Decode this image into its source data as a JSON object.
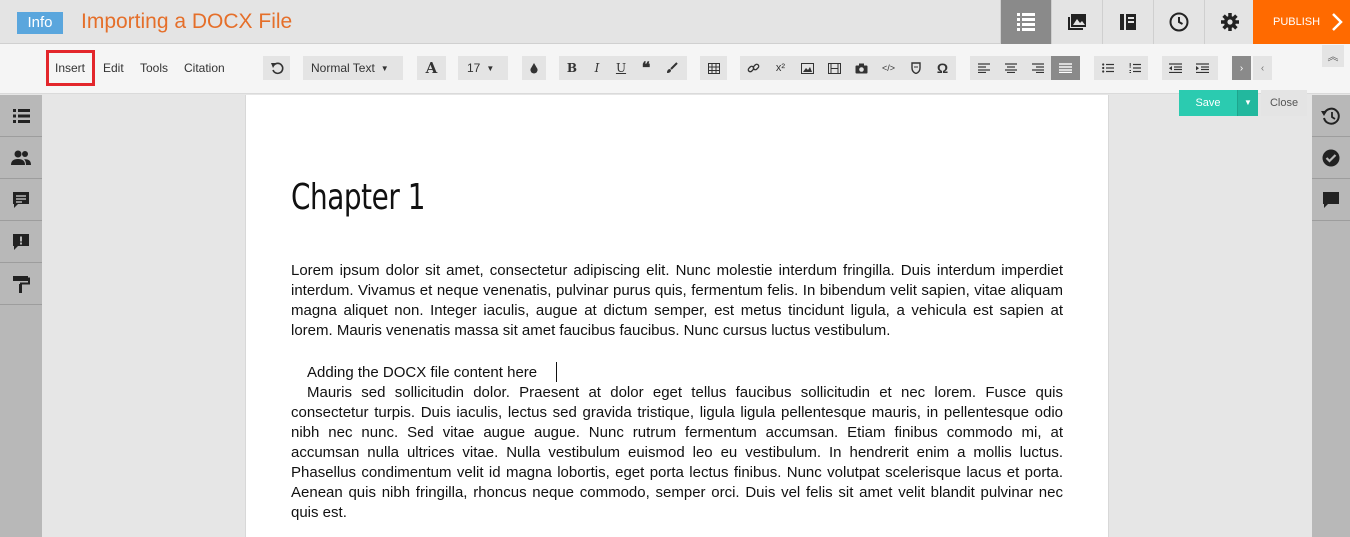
{
  "header": {
    "info_badge": "Info",
    "title": "Importing a DOCX File",
    "publish_label": "PUBLISH",
    "buttons": [
      "toc-icon",
      "media-icon",
      "library-icon",
      "history-icon",
      "gear-icon"
    ]
  },
  "toolbar": {
    "menu": {
      "insert": "Insert",
      "edit": "Edit",
      "tools": "Tools",
      "citation": "Citation"
    },
    "style_select": "Normal Text",
    "font_size": "17",
    "font_letter": "A",
    "bold": "B",
    "italic": "I",
    "underline": "U",
    "superscript": "x²",
    "code": "</>",
    "omega": "Ω"
  },
  "actions": {
    "save": "Save",
    "close": "Close"
  },
  "document": {
    "chapter_title": "Chapter 1",
    "paragraph1": "Lorem ipsum dolor sit amet, consectetur adipiscing elit. Nunc molestie interdum fringilla. Duis interdum imperdiet interdum. Vivamus et neque venenatis, pulvinar purus quis, fermentum felis. In bibendum velit sapien, vitae aliquam magna aliquet non. Integer iaculis, augue at dictum semper, est metus tincidunt ligula, a vehicula est sapien at lorem. Mauris venenatis massa sit amet faucibus faucibus. Nunc cursus luctus vestibulum.",
    "inserted_line": "Adding the DOCX file content here",
    "paragraph2": "Mauris sed sollicitudin dolor. Praesent at dolor eget tellus faucibus sollicitudin et nec lorem. Fusce quis consectetur turpis. Duis iaculis, lectus sed gravida tristique, ligula ligula pellentesque mauris, in pellentesque odio nibh nec nunc. Sed vitae augue augue. Nunc rutrum fermentum accumsan. Etiam finibus commodo mi, at accumsan nulla ultrices vitae. Nulla vestibulum euismod leo eu vestibulum. In hendrerit enim a mollis luctus. Phasellus condimentum velit id magna lobortis, eget porta lectus finibus. Nunc volutpat scelerisque lacus et porta. Aenean quis nibh fringilla, rhoncus neque commodo, semper orci. Duis vel felis sit amet velit blandit pulvinar nec quis est."
  },
  "colors": {
    "title": "#e56f2a",
    "publish": "#ff6a00",
    "save": "#2bcbb0",
    "info": "#5aa6dd",
    "highlight": "#e3262b"
  }
}
